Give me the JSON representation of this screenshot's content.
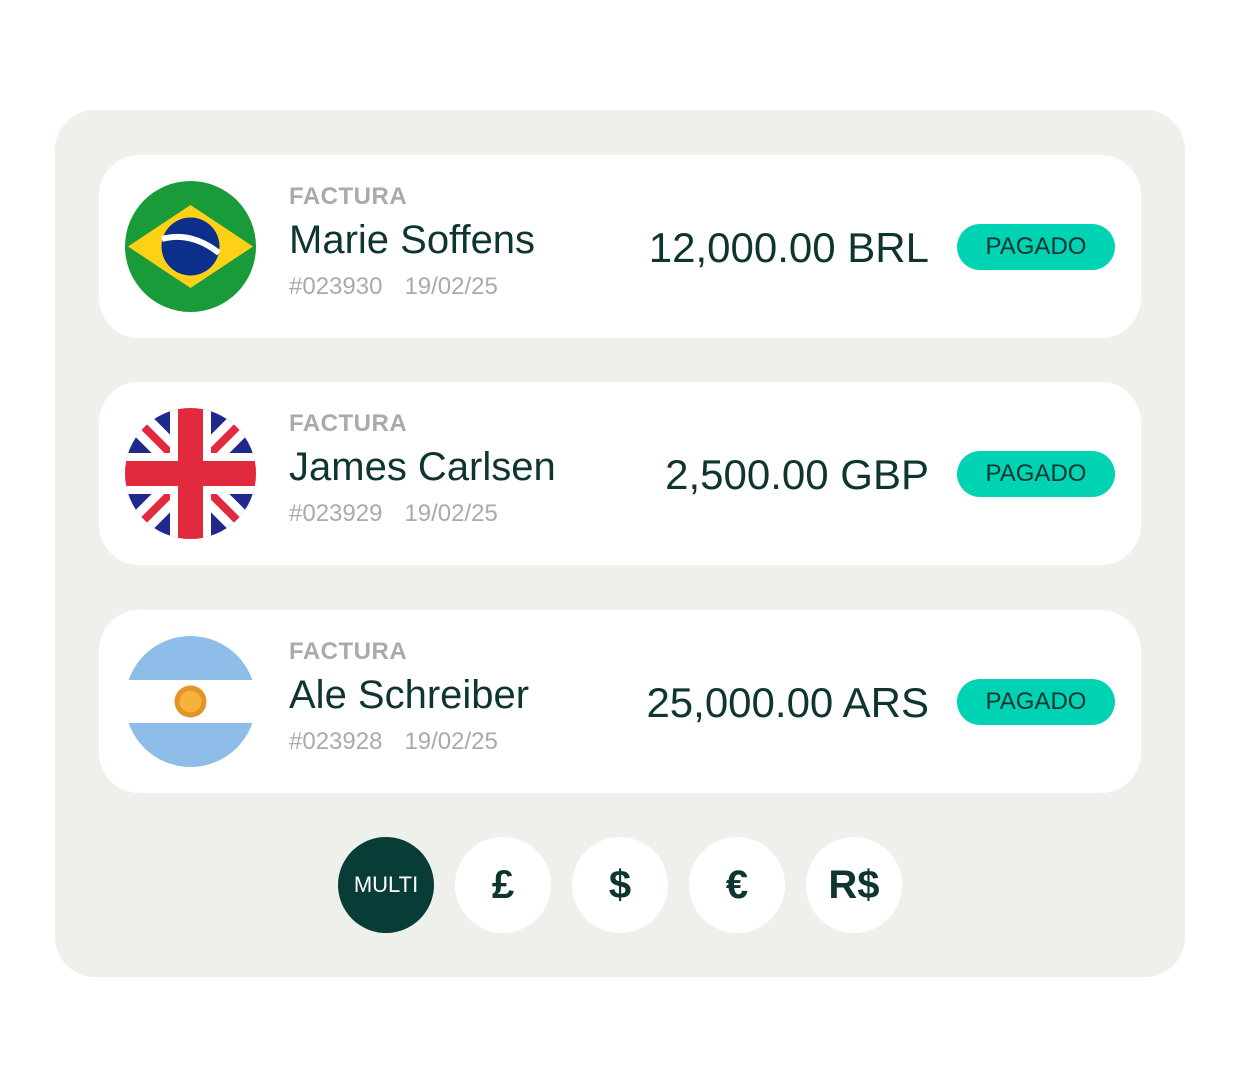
{
  "invoices": [
    {
      "flag_icon": "brazil-flag-icon",
      "label": "FACTURA",
      "name": "Marie Soffens",
      "number": "#023930",
      "date": "19/02/25",
      "amount": "12,000.00 BRL",
      "status": "PAGADO"
    },
    {
      "flag_icon": "uk-flag-icon",
      "label": "FACTURA",
      "name": "James Carlsen",
      "number": "#023929",
      "date": "19/02/25",
      "amount": "2,500.00 GBP",
      "status": "PAGADO"
    },
    {
      "flag_icon": "argentina-flag-icon",
      "label": "FACTURA",
      "name": "Ale Schreiber",
      "number": "#023928",
      "date": "19/02/25",
      "amount": "25,000.00 ARS",
      "status": "PAGADO"
    }
  ],
  "currency_filters": [
    {
      "label": "MULTI",
      "active": true
    },
    {
      "label": "£",
      "active": false
    },
    {
      "label": "$",
      "active": false
    },
    {
      "label": "€",
      "active": false
    },
    {
      "label": "R$",
      "active": false
    }
  ],
  "colors": {
    "panel_background": "#eef0ec",
    "status_badge": "#00d2b4",
    "primary_text": "#0f3530",
    "muted_text": "#a8aba6",
    "active_filter": "#073d36"
  }
}
